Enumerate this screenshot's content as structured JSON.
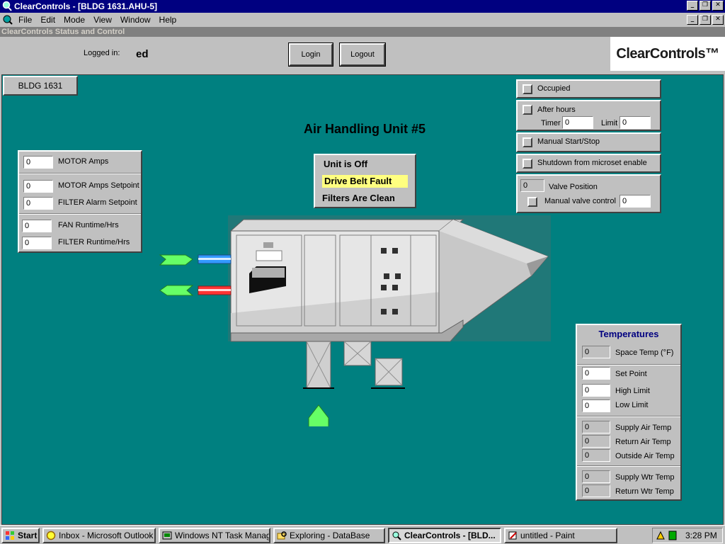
{
  "window": {
    "title": "ClearControls - [BLDG 1631.AHU-5]",
    "subcaption": "ClearControls Status and Control"
  },
  "menu": [
    "File",
    "Edit",
    "Mode",
    "View",
    "Window",
    "Help"
  ],
  "header": {
    "logged_in_label": "Logged in:",
    "user": "ed",
    "login_label": "Login",
    "logout_label": "Logout",
    "logo_text": "ClearControls™"
  },
  "building_tab": "BLDG 1631",
  "unit_title": "Air Handling Unit #5",
  "status": {
    "line1": "Unit is Off",
    "line2": "Drive Belt Fault",
    "line3": "Filters Are Clean",
    "fault_color": "#ffff80"
  },
  "motor_panel": {
    "motor_amps": {
      "value": "0",
      "label": "MOTOR Amps"
    },
    "motor_amps_setpoint": {
      "value": "0",
      "label": "MOTOR Amps Setpoint"
    },
    "filter_alarm_setpoint": {
      "value": "0",
      "label": "FILTER Alarm Setpoint"
    },
    "fan_runtime": {
      "value": "0",
      "label": "FAN Runtime/Hrs"
    },
    "filter_runtime": {
      "value": "0",
      "label": "FILTER Runtime/Hrs"
    }
  },
  "control_panel": {
    "occupied": "Occupied",
    "after_hours": "After hours",
    "timer_label": "Timer",
    "timer_value": "0",
    "limit_label": "Limit",
    "limit_value": "0",
    "manual_start_stop": "Manual Start/Stop",
    "shutdown": "Shutdown from microset enable",
    "valve_position_value": "0",
    "valve_position_label": "Valve Position",
    "manual_valve_label": "Manual valve control",
    "manual_valve_value": "0"
  },
  "temperatures": {
    "title": "Temperatures",
    "space_temp": {
      "value": "0",
      "label": "Space Temp (°F)"
    },
    "set_point": {
      "value": "0",
      "label": "Set Point"
    },
    "high_limit": {
      "value": "0",
      "label": "High Limit"
    },
    "low_limit": {
      "value": "0",
      "label": "Low Limit"
    },
    "supply_air": {
      "value": "0",
      "label": "Supply Air Temp"
    },
    "return_air": {
      "value": "0",
      "label": "Return Air Temp"
    },
    "outside_air": {
      "value": "0",
      "label": "Outside Air Temp"
    },
    "supply_wtr": {
      "value": "0",
      "label": "Supply Wtr Temp"
    },
    "return_wtr": {
      "value": "0",
      "label": "Return Wtr Temp"
    }
  },
  "taskbar": {
    "start": "Start",
    "tasks": [
      "Inbox - Microsoft Outlook",
      "Windows NT Task Manager",
      "Exploring - DataBase",
      "ClearControls - [BLD...",
      "untitled - Paint"
    ],
    "clock": "3:28 PM"
  },
  "colors": {
    "teal": "#008080",
    "titlebar": "#000080",
    "arrow_green": "#66ff66",
    "pipe_blue": "#3399ff",
    "pipe_red": "#ff3333"
  }
}
